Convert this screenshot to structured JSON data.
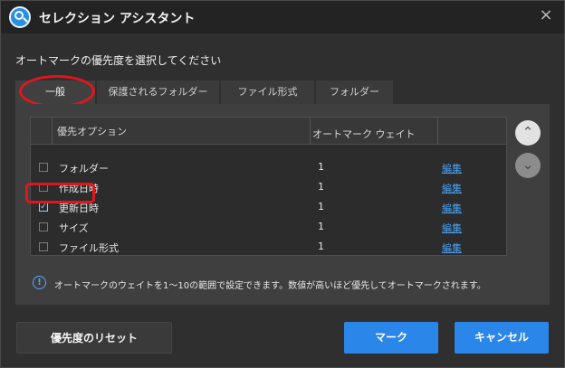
{
  "window": {
    "title": "セレクション アシスタント",
    "close_symbol": "×"
  },
  "instruction": "オートマークの優先度を選択してください",
  "tabs": [
    {
      "label": "一般",
      "active": true
    },
    {
      "label": "保護されるフォルダー",
      "active": false
    },
    {
      "label": "ファイル形式",
      "active": false
    },
    {
      "label": "フォルダー",
      "active": false
    }
  ],
  "table": {
    "headers": {
      "option": "優先オプション",
      "weight": "オートマーク ウェイト"
    },
    "rows": [
      {
        "label": "フォルダー",
        "weight": "1",
        "action": "編集",
        "checked": false
      },
      {
        "label": "作成日時",
        "weight": "1",
        "action": "編集",
        "checked": false
      },
      {
        "label": "更新日時",
        "weight": "1",
        "action": "編集",
        "checked": true
      },
      {
        "label": "サイズ",
        "weight": "1",
        "action": "編集",
        "checked": false
      },
      {
        "label": "ファイル形式",
        "weight": "1",
        "action": "編集",
        "checked": false
      }
    ]
  },
  "info": {
    "icon": "!",
    "text": "オートマークのウェイトを1～10の範囲で設定できます。数値が高いほど優先してオートマークされます。"
  },
  "buttons": {
    "reset": "優先度のリセット",
    "mark": "マーク",
    "cancel": "キャンセル",
    "move_up_symbol": "⌃",
    "move_down_symbol": "⌄"
  },
  "colors": {
    "accent": "#2a86e8",
    "highlight": "#e3151c",
    "link": "#4a9ff0"
  }
}
